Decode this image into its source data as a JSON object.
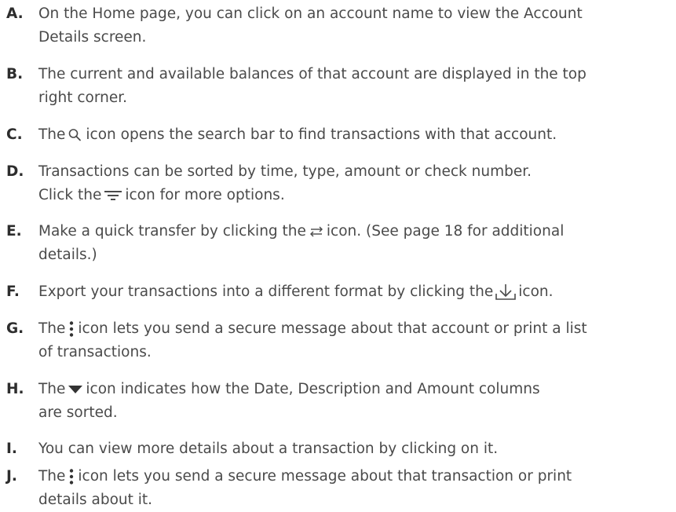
{
  "items": [
    {
      "letter": "A.",
      "line1": "On the Home page, you can click on an account name to view the Account",
      "line2": "Details screen."
    },
    {
      "letter": "B.",
      "line1": "The current and available balances of that account are displayed in the top",
      "line2": "right corner."
    },
    {
      "letter": "C.",
      "pre": "The",
      "icon": "search-icon",
      "post": "icon opens the search bar to find transactions with that account."
    },
    {
      "letter": "D.",
      "line1": "Transactions can be sorted by time, type, amount or check number.",
      "pre": "Click the",
      "icon": "sort-options-icon",
      "post": "icon for more options."
    },
    {
      "letter": "E.",
      "pre": "Make a quick transfer by clicking the",
      "icon": "transfer-icon",
      "post": "icon. (See page 18 for additional",
      "line2": "details.)"
    },
    {
      "letter": "F.",
      "pre": "Export your transactions into a different format by clicking the",
      "icon": "download-icon",
      "post": "icon."
    },
    {
      "letter": "G.",
      "pre": "The",
      "icon": "more-vertical-icon",
      "post": "icon lets you send a secure message about that account or print a list",
      "line2": "of transactions."
    },
    {
      "letter": "H.",
      "pre": "The",
      "icon": "triangle-down-icon",
      "post": "icon indicates how the Date, Description and Amount columns",
      "line2": "are sorted."
    },
    {
      "letter": "I.",
      "line1": "You can view more details about a transaction by clicking on it."
    },
    {
      "letter": "J.",
      "pre": "The",
      "icon": "more-vertical-icon",
      "post": "icon lets you send a secure message about that transaction or print",
      "line2": "details about it."
    }
  ]
}
